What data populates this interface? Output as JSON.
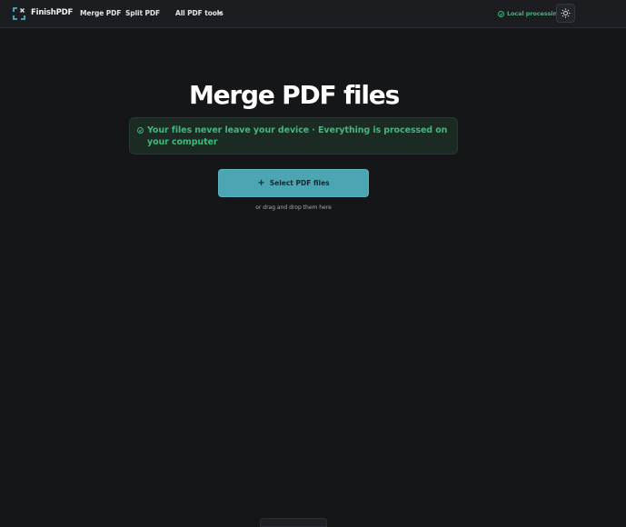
{
  "header": {
    "brand": "FinishPDF",
    "nav": {
      "merge": "Merge PDF",
      "split": "Split PDF",
      "all_tools": "All PDF tools"
    },
    "local_processing": "Local processing"
  },
  "main": {
    "title": "Merge PDF files",
    "notice": "Your files never leave your device · Everything is processed on your computer",
    "select_button": "Select PDF files",
    "drag_hint": "or drag and drop them here"
  },
  "colors": {
    "accent": "#4ca5b3",
    "success": "#3fb97a",
    "background": "#151618"
  },
  "icons": {
    "logo": "finishpdf-logo-icon",
    "chevron": "chevron-down-icon",
    "shield": "shield-check-icon",
    "theme": "sun-icon",
    "plus": "plus-icon"
  }
}
